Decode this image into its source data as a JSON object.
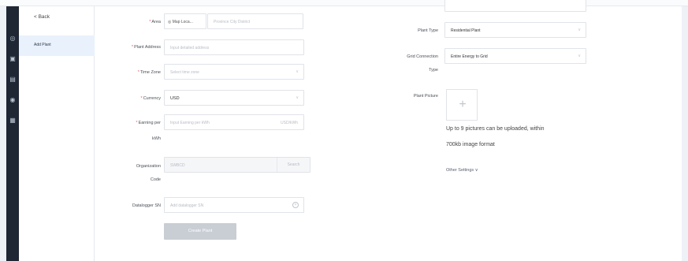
{
  "sidebar": {
    "back_label": "< Back",
    "active_item": "Add Plant",
    "icons": [
      "globe-icon",
      "device-icon",
      "chart-icon",
      "eye-icon",
      "grid-icon"
    ]
  },
  "form": {
    "area": {
      "label": "Area",
      "map_button": "◎ Map Loca...",
      "placeholder": "Province City District"
    },
    "plant_address": {
      "label": "Plant Address",
      "placeholder": "Input detailed address"
    },
    "time_zone": {
      "label": "Time Zone",
      "placeholder": "Select time zone"
    },
    "currency": {
      "label": "Currency",
      "value": "USD"
    },
    "earning": {
      "label": "Earning per",
      "label2": "kWh",
      "placeholder": "Input Earning per kWh",
      "suffix": "USD/kWh"
    },
    "org_code": {
      "label": "Organization",
      "label2": "Code",
      "value": "SWBCD",
      "search_label": "Search"
    },
    "datalogger": {
      "label": "Datalogger SN",
      "placeholder": "Add datalogger SN"
    },
    "create_button": "Create Plant",
    "plant_type": {
      "label": "Plant Type",
      "value": "Residential Plant"
    },
    "grid_connection": {
      "label": "Grid Connection",
      "label2": "Type",
      "value": "Entire Energy to Grid"
    },
    "plant_picture": {
      "label": "Plant Picture",
      "plus": "+",
      "hint_line1": "Up to 9 pictures can be uploaded, within",
      "hint_line2": "700kb image format"
    },
    "other_settings": "Other Settings  ∨"
  }
}
